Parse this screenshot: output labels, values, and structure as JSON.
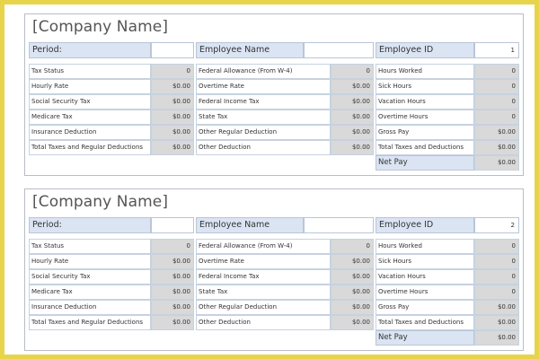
{
  "stubs": [
    {
      "company": "[Company Name]",
      "header": {
        "period_label": "Period:",
        "period_value": "",
        "employee_label": "Employee Name",
        "employee_value": "",
        "id_label": "Employee ID",
        "id_value": "1"
      },
      "col1": [
        {
          "label": "Tax Status",
          "value": "0"
        },
        {
          "label": "Hourly Rate",
          "value": "$0.00"
        },
        {
          "label": "Social Security Tax",
          "value": "$0.00"
        },
        {
          "label": "Medicare Tax",
          "value": "$0.00"
        },
        {
          "label": "Insurance Deduction",
          "value": "$0.00"
        },
        {
          "label": "Total Taxes and Regular Deductions",
          "value": "$0.00"
        }
      ],
      "col2": [
        {
          "label": "Federal Allowance (From W-4)",
          "value": "0"
        },
        {
          "label": "Overtime Rate",
          "value": "$0.00"
        },
        {
          "label": "Federal Income Tax",
          "value": "$0.00"
        },
        {
          "label": "State Tax",
          "value": "$0.00"
        },
        {
          "label": "Other Regular Deduction",
          "value": "$0.00"
        },
        {
          "label": "Other Deduction",
          "value": "$0.00"
        }
      ],
      "col3": [
        {
          "label": "Hours Worked",
          "value": "0"
        },
        {
          "label": "Sick Hours",
          "value": "0"
        },
        {
          "label": "Vacation Hours",
          "value": "0"
        },
        {
          "label": "Overtime Hours",
          "value": "0"
        },
        {
          "label": "Gross Pay",
          "value": "$0.00"
        },
        {
          "label": "Total Taxes and Deductions",
          "value": "$0.00"
        }
      ],
      "net": {
        "label": "Net Pay",
        "value": "$0.00"
      }
    },
    {
      "company": "[Company Name]",
      "header": {
        "period_label": "Period:",
        "period_value": "",
        "employee_label": "Employee Name",
        "employee_value": "",
        "id_label": "Employee ID",
        "id_value": "2"
      },
      "col1": [
        {
          "label": "Tax Status",
          "value": "0"
        },
        {
          "label": "Hourly Rate",
          "value": "$0.00"
        },
        {
          "label": "Social Security Tax",
          "value": "$0.00"
        },
        {
          "label": "Medicare Tax",
          "value": "$0.00"
        },
        {
          "label": "Insurance Deduction",
          "value": "$0.00"
        },
        {
          "label": "Total Taxes and Regular Deductions",
          "value": "$0.00"
        }
      ],
      "col2": [
        {
          "label": "Federal Allowance (From W-4)",
          "value": "0"
        },
        {
          "label": "Overtime Rate",
          "value": "$0.00"
        },
        {
          "label": "Federal Income Tax",
          "value": "$0.00"
        },
        {
          "label": "State Tax",
          "value": "$0.00"
        },
        {
          "label": "Other Regular Deduction",
          "value": "$0.00"
        },
        {
          "label": "Other Deduction",
          "value": "$0.00"
        }
      ],
      "col3": [
        {
          "label": "Hours Worked",
          "value": "0"
        },
        {
          "label": "Sick Hours",
          "value": "0"
        },
        {
          "label": "Vacation Hours",
          "value": "0"
        },
        {
          "label": "Overtime Hours",
          "value": "0"
        },
        {
          "label": "Gross Pay",
          "value": "$0.00"
        },
        {
          "label": "Total Taxes and Deductions",
          "value": "$0.00"
        }
      ],
      "net": {
        "label": "Net Pay",
        "value": "$0.00"
      }
    }
  ]
}
